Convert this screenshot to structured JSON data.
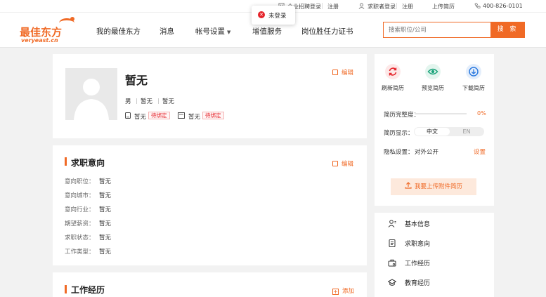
{
  "topbar": {
    "employer_login": "企业招聘登录",
    "employer_register": "注册",
    "seeker_login": "求职者登录",
    "seeker_register": "注册",
    "upload_resume": "上传简历",
    "phone": "400-826-0101"
  },
  "toast": {
    "text": "未登录"
  },
  "header": {
    "logo_text": "最佳东方",
    "logo_domain": "veryeast.cn",
    "nav": [
      {
        "label": "我的最佳东方"
      },
      {
        "label": "消息"
      },
      {
        "label": "帐号设置"
      },
      {
        "label": "增值服务"
      },
      {
        "label": "岗位胜任力证书"
      }
    ],
    "search_placeholder": "搜索职位/公司",
    "search_button": "搜 索"
  },
  "profile": {
    "name": "暂无",
    "edit_label": "编辑",
    "gender": "男",
    "info1": "暂无",
    "info2": "暂无",
    "phone": "暂无",
    "phone_tag": "待绑定",
    "email": "暂无",
    "email_tag": "待绑定"
  },
  "intention": {
    "title": "求职意向",
    "edit_label": "编辑",
    "fields": [
      {
        "label": "意向职位：",
        "value": "暂无"
      },
      {
        "label": "意向城市：",
        "value": "暂无"
      },
      {
        "label": "意向行业：",
        "value": "暂无"
      },
      {
        "label": "期望薪资：",
        "value": "暂无"
      },
      {
        "label": "求职状态：",
        "value": "暂无"
      },
      {
        "label": "工作类型：",
        "value": "暂无"
      }
    ]
  },
  "experience": {
    "title": "工作经历",
    "add_label": "添加"
  },
  "sidebar": {
    "actions": [
      {
        "label": "刷新简历",
        "icon": "refresh-icon",
        "color": "#e5242b"
      },
      {
        "label": "预览简历",
        "icon": "eye-icon",
        "color": "#1aa37a"
      },
      {
        "label": "下载简历",
        "icon": "download-icon",
        "color": "#2d7be0"
      }
    ],
    "completeness_label": "简历完整度：",
    "completeness_value": "0%",
    "completeness": 0,
    "display_label": "简历显示：",
    "display_options": [
      "中文",
      "EN"
    ],
    "privacy_label": "隐私设置：",
    "privacy_value": "对外公开",
    "privacy_link": "设置",
    "upload_attachment": "我要上传附件简历"
  },
  "menu": [
    {
      "label": "基本信息",
      "icon": "user-icon"
    },
    {
      "label": "求职意向",
      "icon": "document-icon"
    },
    {
      "label": "工作经历",
      "icon": "briefcase-icon"
    },
    {
      "label": "教育经历",
      "icon": "graduation-cap-icon"
    }
  ],
  "colors": {
    "accent": "#f06a26",
    "bg": "#f2f2f2",
    "tag_red": "#e5242b"
  }
}
